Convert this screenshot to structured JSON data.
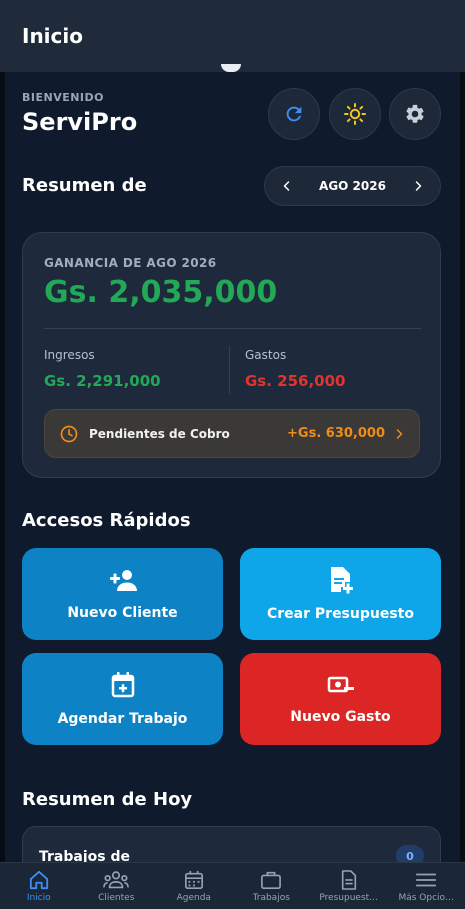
{
  "topbar": {
    "title": "Inicio"
  },
  "welcome": {
    "greeting": "BIENVENIDO",
    "brand": "ServiPro"
  },
  "summary": {
    "label": "Resumen de",
    "period": "AGO 2026",
    "card_label": "GANANCIA DE AGO 2026",
    "profit": "Gs. 2,035,000",
    "income_label": "Ingresos",
    "income_value": "Gs. 2,291,000",
    "expense_label": "Gastos",
    "expense_value": "Gs. 256,000",
    "pending_label": "Pendientes de Cobro",
    "pending_value": "+Gs. 630,000"
  },
  "quick_access": {
    "title": "Accesos Rápidos",
    "items": [
      {
        "label": "Nuevo Cliente",
        "icon": "person-add-icon",
        "color": "#0d83c6"
      },
      {
        "label": "Crear Presupuesto",
        "icon": "document-add-icon",
        "color": "#0ea5e9"
      },
      {
        "label": "Agendar Trabajo",
        "icon": "calendar-add-icon",
        "color": "#0d83c6"
      },
      {
        "label": "Nuevo Gasto",
        "icon": "cash-minus-icon",
        "color": "#dc2626"
      }
    ]
  },
  "today": {
    "title": "Resumen de Hoy",
    "jobs_label": "Trabajos de",
    "jobs_count": "0"
  },
  "nav": {
    "items": [
      {
        "label": "Inicio",
        "icon": "home-icon"
      },
      {
        "label": "Clientes",
        "icon": "people-icon"
      },
      {
        "label": "Agenda",
        "icon": "calendar-icon"
      },
      {
        "label": "Trabajos",
        "icon": "briefcase-icon"
      },
      {
        "label": "Presupuest…",
        "icon": "document-icon"
      },
      {
        "label": "Más Opcio…",
        "icon": "menu-icon"
      }
    ]
  },
  "colors": {
    "accent": "#3d8ff5",
    "profit": "#22a957",
    "expense": "#e0342e",
    "pending": "#f08c1a",
    "background": "#0f1a2c"
  }
}
